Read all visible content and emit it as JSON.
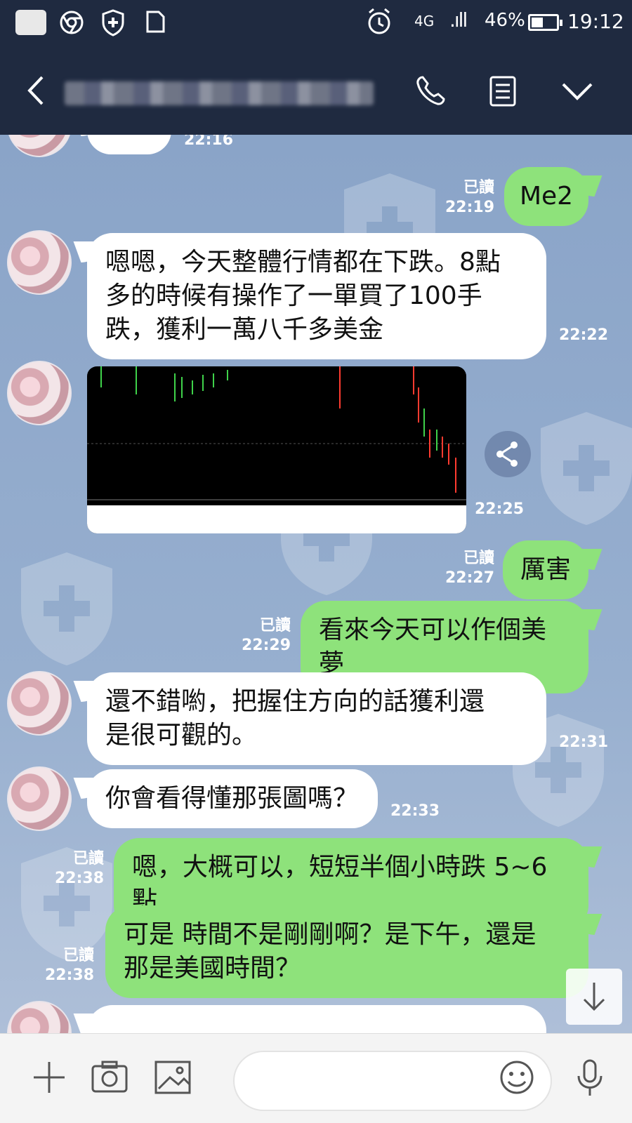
{
  "status_bar": {
    "network": "4G",
    "battery_pct": "46%",
    "battery_level": 0.46,
    "time": "19:12"
  },
  "header": {
    "back_icon": "chevron-left-icon",
    "call_icon": "phone-icon",
    "notes_icon": "notes-icon",
    "menu_icon": "chevron-down-icon"
  },
  "messages": [
    {
      "side": "in",
      "text": "",
      "time": "22:16"
    },
    {
      "side": "out",
      "text": "Me2",
      "read": "已讀",
      "time": "22:19"
    },
    {
      "side": "in",
      "lines": [
        "嗯嗯，今天整體行情都在下跌。8點",
        "多的時候有操作了一單買了100手",
        "跌，獲利一萬八千多美金"
      ],
      "time": "22:22"
    },
    {
      "side": "in",
      "type": "image",
      "time": "22:25"
    },
    {
      "side": "out",
      "text": "厲害",
      "read": "已讀",
      "time": "22:27"
    },
    {
      "side": "out",
      "text": "看來今天可以作個美夢",
      "read": "已讀",
      "time": "22:29"
    },
    {
      "side": "in",
      "lines": [
        "還不錯喲，把握住方向的話獲利還",
        "是很可觀的。"
      ],
      "time": "22:31"
    },
    {
      "side": "in",
      "text": "你會看得懂那張圖嗎？",
      "time": "22:33"
    },
    {
      "side": "out",
      "text": "嗯，大概可以，短短半個小時跌 5~6點",
      "read": "已讀",
      "time": "22:38"
    },
    {
      "side": "out",
      "lines": [
        "可是 時間不是剛剛啊？是下午，還是",
        "那是美國時間？"
      ],
      "read": "已讀",
      "time": "22:38"
    }
  ],
  "input_bar": {
    "plus_icon": "plus-icon",
    "camera_icon": "camera-icon",
    "image_icon": "image-icon",
    "emoji_icon": "emoji-icon",
    "mic_icon": "mic-icon",
    "placeholder": ""
  },
  "colors": {
    "header_bg": "#1f2a40",
    "incoming_bubble": "#ffffff",
    "outgoing_bubble": "#8ee27b",
    "chat_bg": "#8ea6c8"
  }
}
